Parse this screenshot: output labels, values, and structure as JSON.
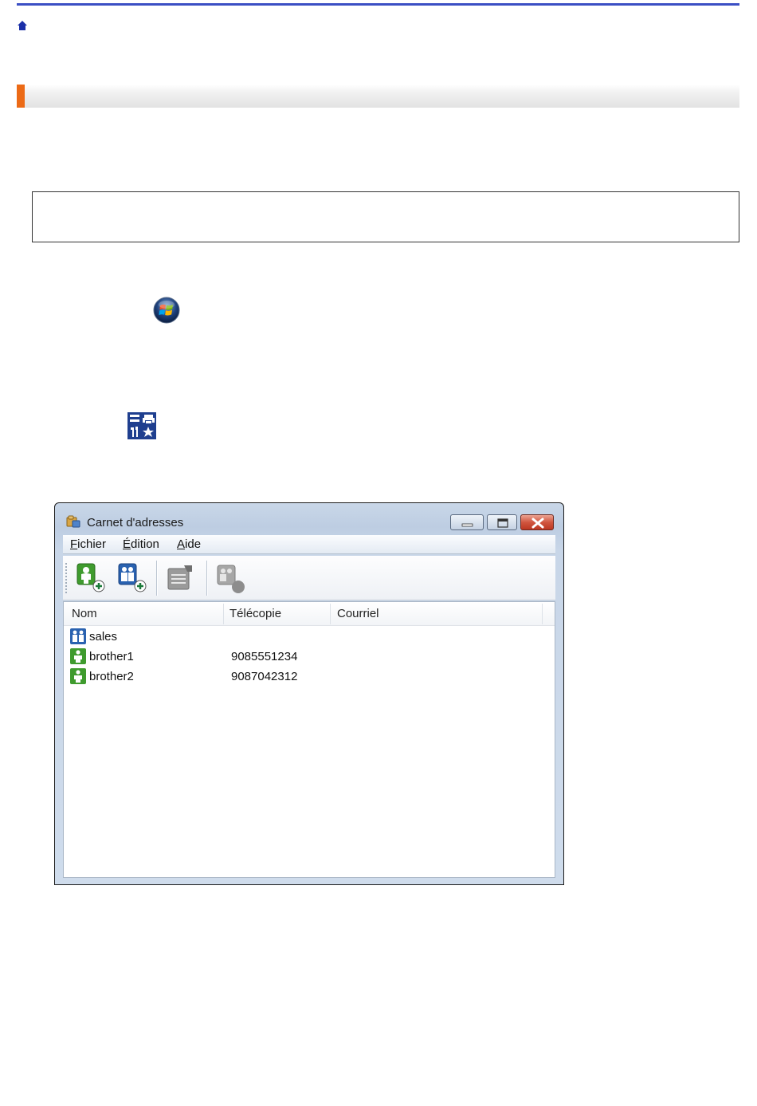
{
  "window": {
    "title": "Carnet d'adresses",
    "menu": [
      {
        "label": "Fichier",
        "mnemonic": "F",
        "rest": "ichier"
      },
      {
        "label": "Édition",
        "mnemonic": "É",
        "rest": "dition"
      },
      {
        "label": "Aide",
        "mnemonic": "A",
        "rest": "ide"
      }
    ],
    "toolbar": [
      {
        "icon": "add-contact-icon",
        "enabled": true
      },
      {
        "icon": "add-group-icon",
        "enabled": true
      },
      {
        "icon": "edit-icon",
        "enabled": false
      },
      {
        "icon": "delete-icon",
        "enabled": false
      }
    ],
    "columns": [
      "Nom",
      "Télécopie",
      "Courriel"
    ],
    "rows": [
      {
        "type": "group",
        "icon": "group-icon",
        "name": "sales",
        "fax": "",
        "email": ""
      },
      {
        "type": "contact",
        "icon": "contact-icon",
        "name": "brother1",
        "fax": "9085551234",
        "email": ""
      },
      {
        "type": "contact",
        "icon": "contact-icon",
        "name": "brother2",
        "fax": "9087042312",
        "email": ""
      }
    ]
  },
  "colors": {
    "top_rule": "#3b4fc4",
    "section_accent": "#ec6a16",
    "contact_green": "#3f9b2e",
    "group_blue": "#2a62b0"
  },
  "icons": {
    "home": "home-icon",
    "start": "windows-start-icon",
    "control_panel": "brother-utilities-icon"
  }
}
